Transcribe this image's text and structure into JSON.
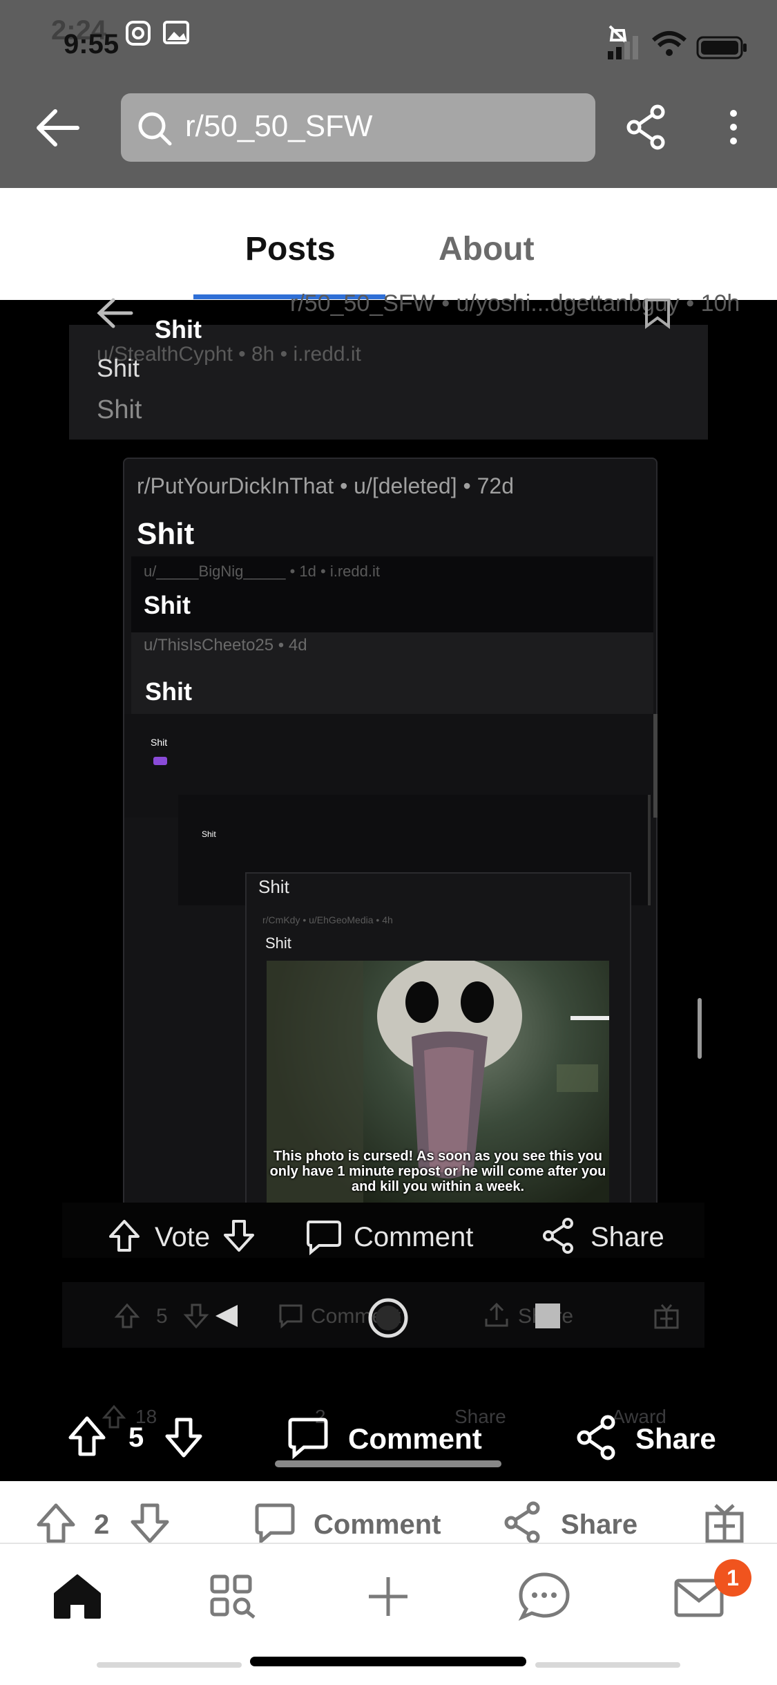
{
  "status": {
    "time_front": "9:55",
    "time_back": "2:24"
  },
  "header": {
    "search_text": "r/50_50_SFW"
  },
  "tabs": [
    "Posts",
    "About"
  ],
  "embedded": {
    "nested_header_sub": "r/50_50_SFW • u/yoshi...dgettanbguy • 10h",
    "title1": "Shit",
    "meta1": "u/StealthCypht • 8h • i.redd.it",
    "title2": "Shit",
    "title3": "Shit",
    "card_meta": "r/PutYourDickInThat • u/[deleted] • 72d",
    "card_title": "Shit",
    "inner_meta1": "u/_____BigNig_____ • 1d • i.redd.it",
    "inner_title1": "Shit",
    "inner_meta2": "u/ThisIsCheeto25 • 4d",
    "inner_title2": "Shit",
    "deep_title1": "Shit",
    "deep_title2": "Shit",
    "deep_title3": "Shit",
    "deep_meta": "r/CmKdy • u/EhGeoMedia • 4h",
    "deep_title4": "Shit",
    "caption": "This photo is cursed! As soon as you see this you only have 1 minute repost or he will come after you and kill you within a week.",
    "bar1": {
      "vote": "Vote",
      "comment": "Comment",
      "share": "Share"
    },
    "bar2": {
      "count": "5",
      "comment": "Comment",
      "share": "Share"
    },
    "ghost_bar": {
      "count": "18",
      "comment": "2",
      "share": "Share",
      "award": "Award"
    },
    "bar3": {
      "count": "5",
      "comment": "Comment",
      "share": "Share"
    }
  },
  "page_actions": {
    "count": "2",
    "comment": "Comment",
    "share": "Share"
  },
  "notifications_badge": "1"
}
